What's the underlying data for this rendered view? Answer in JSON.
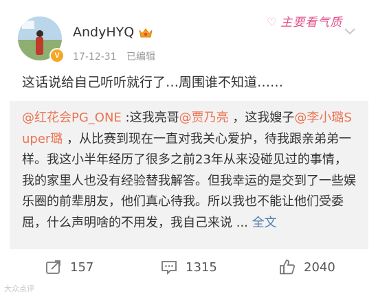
{
  "post": {
    "username": "AndyHYQ",
    "date": "17-12-31",
    "edited_label": "已编辑",
    "text": "这话说给自己听听就行了…周围谁不知道……",
    "decoration": "主要看气质"
  },
  "repost": {
    "segments": [
      {
        "text": "@红花会PG_ONE",
        "style": "link"
      },
      {
        "text": " :这我亮哥",
        "style": "plain"
      },
      {
        "text": "@贾乃亮",
        "style": "link"
      },
      {
        "text": " ，这我嫂子",
        "style": "plain"
      },
      {
        "text": "@李小璐Super璐",
        "style": "link"
      },
      {
        "text": " ，从比赛到现在一直对我关心爱护，待我跟亲弟弟一样。我这小半年经历了很多之前23年从来没碰见过的事情，我的家里人也没有经验替我解答。但我幸运的是交到了一些娱乐圈的前辈朋友，他们真心待我。所以我也不能让他们受委屈，什么声明啥的不用发，我自己来说 ... ",
        "style": "plain"
      },
      {
        "text": "全文",
        "style": "blue"
      }
    ]
  },
  "actions": {
    "repost_count": "157",
    "comment_count": "1315",
    "like_count": "2040"
  },
  "icons": {
    "repost": "repost-icon",
    "comment": "comment-icon",
    "like": "thumbs-up-icon",
    "menu": "chevron-down-icon",
    "crown": "crown-icon"
  },
  "watermark": "大众点评"
}
